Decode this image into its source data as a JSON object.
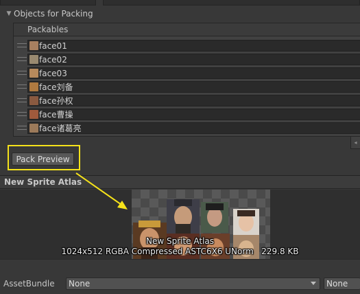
{
  "objects_section": {
    "title": "Objects for Packing",
    "list_header": "Packables",
    "items": [
      {
        "label": "face01",
        "thumb_color": "#a88060"
      },
      {
        "label": "face02",
        "thumb_color": "#9a8a70"
      },
      {
        "label": "face03",
        "thumb_color": "#b78a5c"
      },
      {
        "label": "face刘备",
        "thumb_color": "#b07a40"
      },
      {
        "label": "face孙权",
        "thumb_color": "#8a5a40"
      },
      {
        "label": "face曹操",
        "thumb_color": "#a05a3c"
      },
      {
        "label": "face诸葛亮",
        "thumb_color": "#9c7a5a"
      }
    ]
  },
  "pack_preview_button": "Pack Preview",
  "preview": {
    "title": "New Sprite Atlas",
    "atlas_name": "New Sprite Atlas",
    "atlas_info": "1024x512 RGBA Compressed ASTC6X6 UNorm   229.8 KB"
  },
  "asset_bundle": {
    "label": "AssetBundle",
    "name_value": "None",
    "variant_value": "None"
  },
  "colors": {
    "highlight": "#f5e21a",
    "arrow": "#f5e21a"
  }
}
